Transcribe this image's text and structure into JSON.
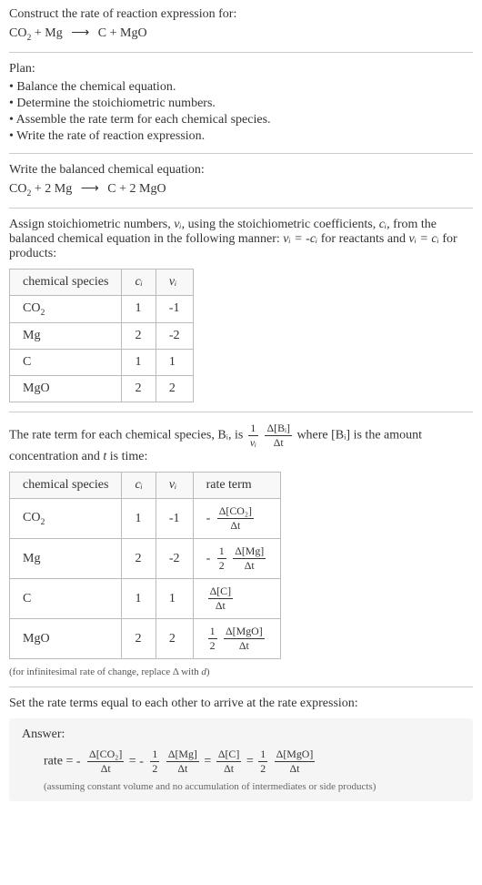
{
  "header": {
    "prompt": "Construct the rate of reaction expression for:",
    "equation": "CO₂ + Mg ⟶ C + MgO"
  },
  "plan": {
    "title": "Plan:",
    "items": [
      "Balance the chemical equation.",
      "Determine the stoichiometric numbers.",
      "Assemble the rate term for each chemical species.",
      "Write the rate of reaction expression."
    ]
  },
  "balanced": {
    "title": "Write the balanced chemical equation:",
    "equation": "CO₂ + 2 Mg ⟶ C + 2 MgO"
  },
  "stoich": {
    "intro_part1": "Assign stoichiometric numbers, ",
    "nu_i": "νᵢ",
    "intro_part2": ", using the stoichiometric coefficients, ",
    "c_i": "cᵢ",
    "intro_part3": ", from the balanced chemical equation in the following manner: ",
    "relation1": "νᵢ = -cᵢ",
    "intro_part4": " for reactants and ",
    "relation2": "νᵢ = cᵢ",
    "intro_part5": " for products:",
    "headers": {
      "species": "chemical species",
      "ci": "cᵢ",
      "nui": "νᵢ"
    },
    "rows": [
      {
        "species": "CO₂",
        "ci": "1",
        "nui": "-1"
      },
      {
        "species": "Mg",
        "ci": "2",
        "nui": "-2"
      },
      {
        "species": "C",
        "ci": "1",
        "nui": "1"
      },
      {
        "species": "MgO",
        "ci": "2",
        "nui": "2"
      }
    ]
  },
  "rateterm": {
    "intro_part1": "The rate term for each chemical species, ",
    "B_i": "Bᵢ",
    "intro_part2": ", is ",
    "one": "1",
    "nu_i": "νᵢ",
    "delta_Bi": "Δ[Bᵢ]",
    "delta_t": "Δt",
    "intro_part3": " where ",
    "conc_Bi": "[Bᵢ]",
    "intro_part4": " is the amount concentration and ",
    "t_var": "t",
    "intro_part5": " is time:",
    "headers": {
      "species": "chemical species",
      "ci": "cᵢ",
      "nui": "νᵢ",
      "rate": "rate term"
    },
    "rows": [
      {
        "species": "CO₂",
        "ci": "1",
        "nui": "-1",
        "num": "Δ[CO₂]",
        "den": "Δt",
        "pre": "-"
      },
      {
        "species": "Mg",
        "ci": "2",
        "nui": "-2",
        "fnum": "1",
        "fden": "2",
        "num": "Δ[Mg]",
        "den": "Δt",
        "pre": "-"
      },
      {
        "species": "C",
        "ci": "1",
        "nui": "1",
        "num": "Δ[C]",
        "den": "Δt",
        "pre": ""
      },
      {
        "species": "MgO",
        "ci": "2",
        "nui": "2",
        "fnum": "1",
        "fden": "2",
        "num": "Δ[MgO]",
        "den": "Δt",
        "pre": ""
      }
    ],
    "note": "(for infinitesimal rate of change, replace Δ with d)"
  },
  "final": {
    "title": "Set the rate terms equal to each other to arrive at the rate expression:",
    "answer_label": "Answer:",
    "rate_label": "rate = ",
    "minus": "-",
    "eq": " = ",
    "half_num": "1",
    "half_den": "2",
    "t1_num": "Δ[CO₂]",
    "t1_den": "Δt",
    "t2_num": "Δ[Mg]",
    "t2_den": "Δt",
    "t3_num": "Δ[C]",
    "t3_den": "Δt",
    "t4_num": "Δ[MgO]",
    "t4_den": "Δt",
    "assume": "(assuming constant volume and no accumulation of intermediates or side products)"
  },
  "chart_data": {
    "type": "table",
    "stoich_table": {
      "columns": [
        "chemical species",
        "cᵢ",
        "νᵢ"
      ],
      "rows": [
        [
          "CO₂",
          1,
          -1
        ],
        [
          "Mg",
          2,
          -2
        ],
        [
          "C",
          1,
          1
        ],
        [
          "MgO",
          2,
          2
        ]
      ]
    },
    "rate_table": {
      "columns": [
        "chemical species",
        "cᵢ",
        "νᵢ",
        "rate term"
      ],
      "rows": [
        [
          "CO₂",
          1,
          -1,
          "-Δ[CO₂]/Δt"
        ],
        [
          "Mg",
          2,
          -2,
          "-(1/2) Δ[Mg]/Δt"
        ],
        [
          "C",
          1,
          1,
          "Δ[C]/Δt"
        ],
        [
          "MgO",
          2,
          2,
          "(1/2) Δ[MgO]/Δt"
        ]
      ]
    },
    "rate_expression": "rate = -Δ[CO₂]/Δt = -(1/2) Δ[Mg]/Δt = Δ[C]/Δt = (1/2) Δ[MgO]/Δt"
  }
}
